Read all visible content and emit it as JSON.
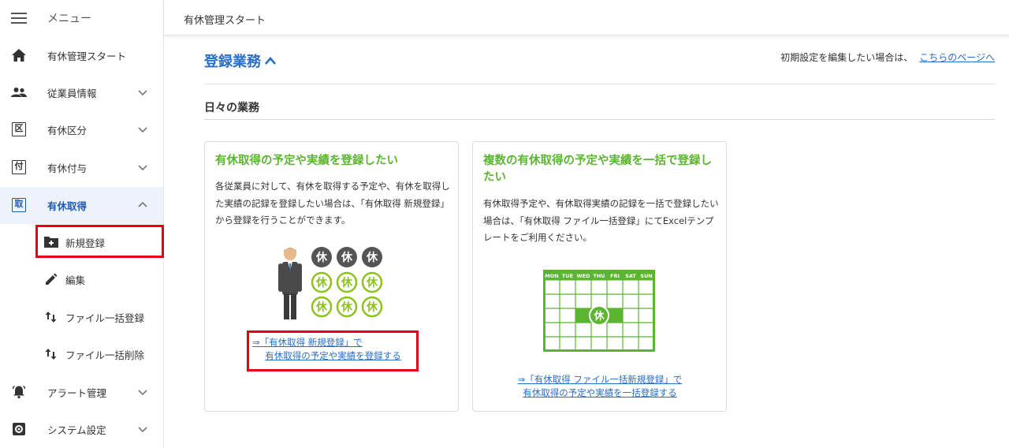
{
  "sidebar": {
    "menu_label": "メニュー",
    "items": [
      {
        "label": "有休管理スタート",
        "icon": "home-icon"
      },
      {
        "label": "従業員情報",
        "icon": "people-icon"
      },
      {
        "label": "有休区分",
        "icon": "ku-icon",
        "glyph": "区"
      },
      {
        "label": "有休付与",
        "icon": "fu-icon",
        "glyph": "付"
      },
      {
        "label": "有休取得",
        "icon": "shu-icon",
        "glyph": "取"
      },
      {
        "label": "アラート管理",
        "icon": "bell-icon"
      },
      {
        "label": "システム設定",
        "icon": "settings-icon"
      }
    ],
    "sub_items": [
      {
        "label": "新規登録",
        "icon": "add-calendar-icon"
      },
      {
        "label": "編集",
        "icon": "pencil-icon"
      },
      {
        "label": "ファイル一括登録",
        "icon": "swap-vertical-icon"
      },
      {
        "label": "ファイル一括削除",
        "icon": "swap-vertical-icon"
      }
    ]
  },
  "header": {
    "title": "有休管理スタート"
  },
  "main": {
    "section_title": "登録業務",
    "hint_text": "初期設定を編集したい場合は、",
    "hint_link": "こちらのページへ",
    "subsection_title": "日々の業務",
    "cards": [
      {
        "title": "有休取得の予定や実績を登録したい",
        "desc": "各従業員に対して、有休を取得する予定や、有休を取得した実績の記録を登録したい場合は、「有休取得 新規登録」から登録を行うことができます。",
        "illust_glyph": "休",
        "link_line1": "⇒「有休取得 新規登録」で",
        "link_line2": "有休取得の予定や実績を登録する"
      },
      {
        "title": "複数の有休取得の予定や実績を一括で登録したい",
        "desc": "有休取得予定や、有休取得実績の記録を一括で登録したい場合は、「有休取得 ファイル一括登録」にてExcelテンプレートをご利用ください。",
        "illust_days": [
          "MON",
          "TUE",
          "WED",
          "THU",
          "FRI",
          "SAT",
          "SUN"
        ],
        "illust_glyph": "休",
        "link_line1": "⇒「有休取得 ファイル一括新規登録」で",
        "link_line2": "有休取得の予定や実績を一括登録する"
      }
    ]
  },
  "colors": {
    "accent_blue": "#2a6ec5",
    "green": "#5cb531",
    "highlight_red": "#e60012",
    "active_bg": "#eef3fb"
  }
}
